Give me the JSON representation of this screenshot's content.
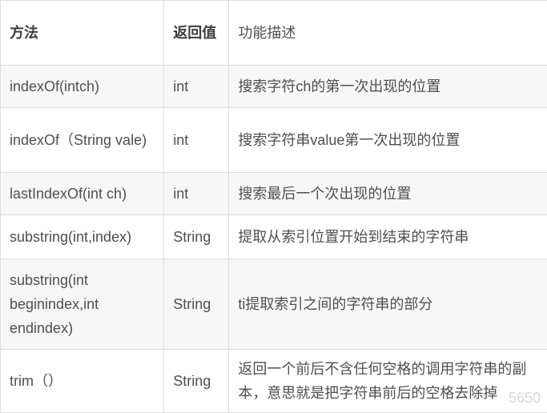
{
  "table": {
    "headers": [
      "方法",
      "返回值",
      "功能描述"
    ],
    "rows": [
      {
        "method": "indexOf(intch)",
        "return": "int",
        "desc": "搜索字符ch的第一次出现的位置"
      },
      {
        "method": "indexOf（String vale)",
        "return": "int",
        "desc": "搜索字符串value第一次出现的位置"
      },
      {
        "method": "lastIndexOf(int ch)",
        "return": "int",
        "desc": "搜索最后一个次出现的位置"
      },
      {
        "method": "substring(int,index)",
        "return": "String",
        "desc": "提取从索引位置开始到结束的字符串"
      },
      {
        "method": "substring(int beginindex,int endindex)",
        "return": "String",
        "desc": "ti提取索引之间的字符串的部分"
      },
      {
        "method": "trim（）",
        "return": "String",
        "desc": "返回一个前后不含任何空格的调用字符串的副本，意思就是把字符串前后的空格去除掉"
      }
    ]
  },
  "watermark": "5650"
}
